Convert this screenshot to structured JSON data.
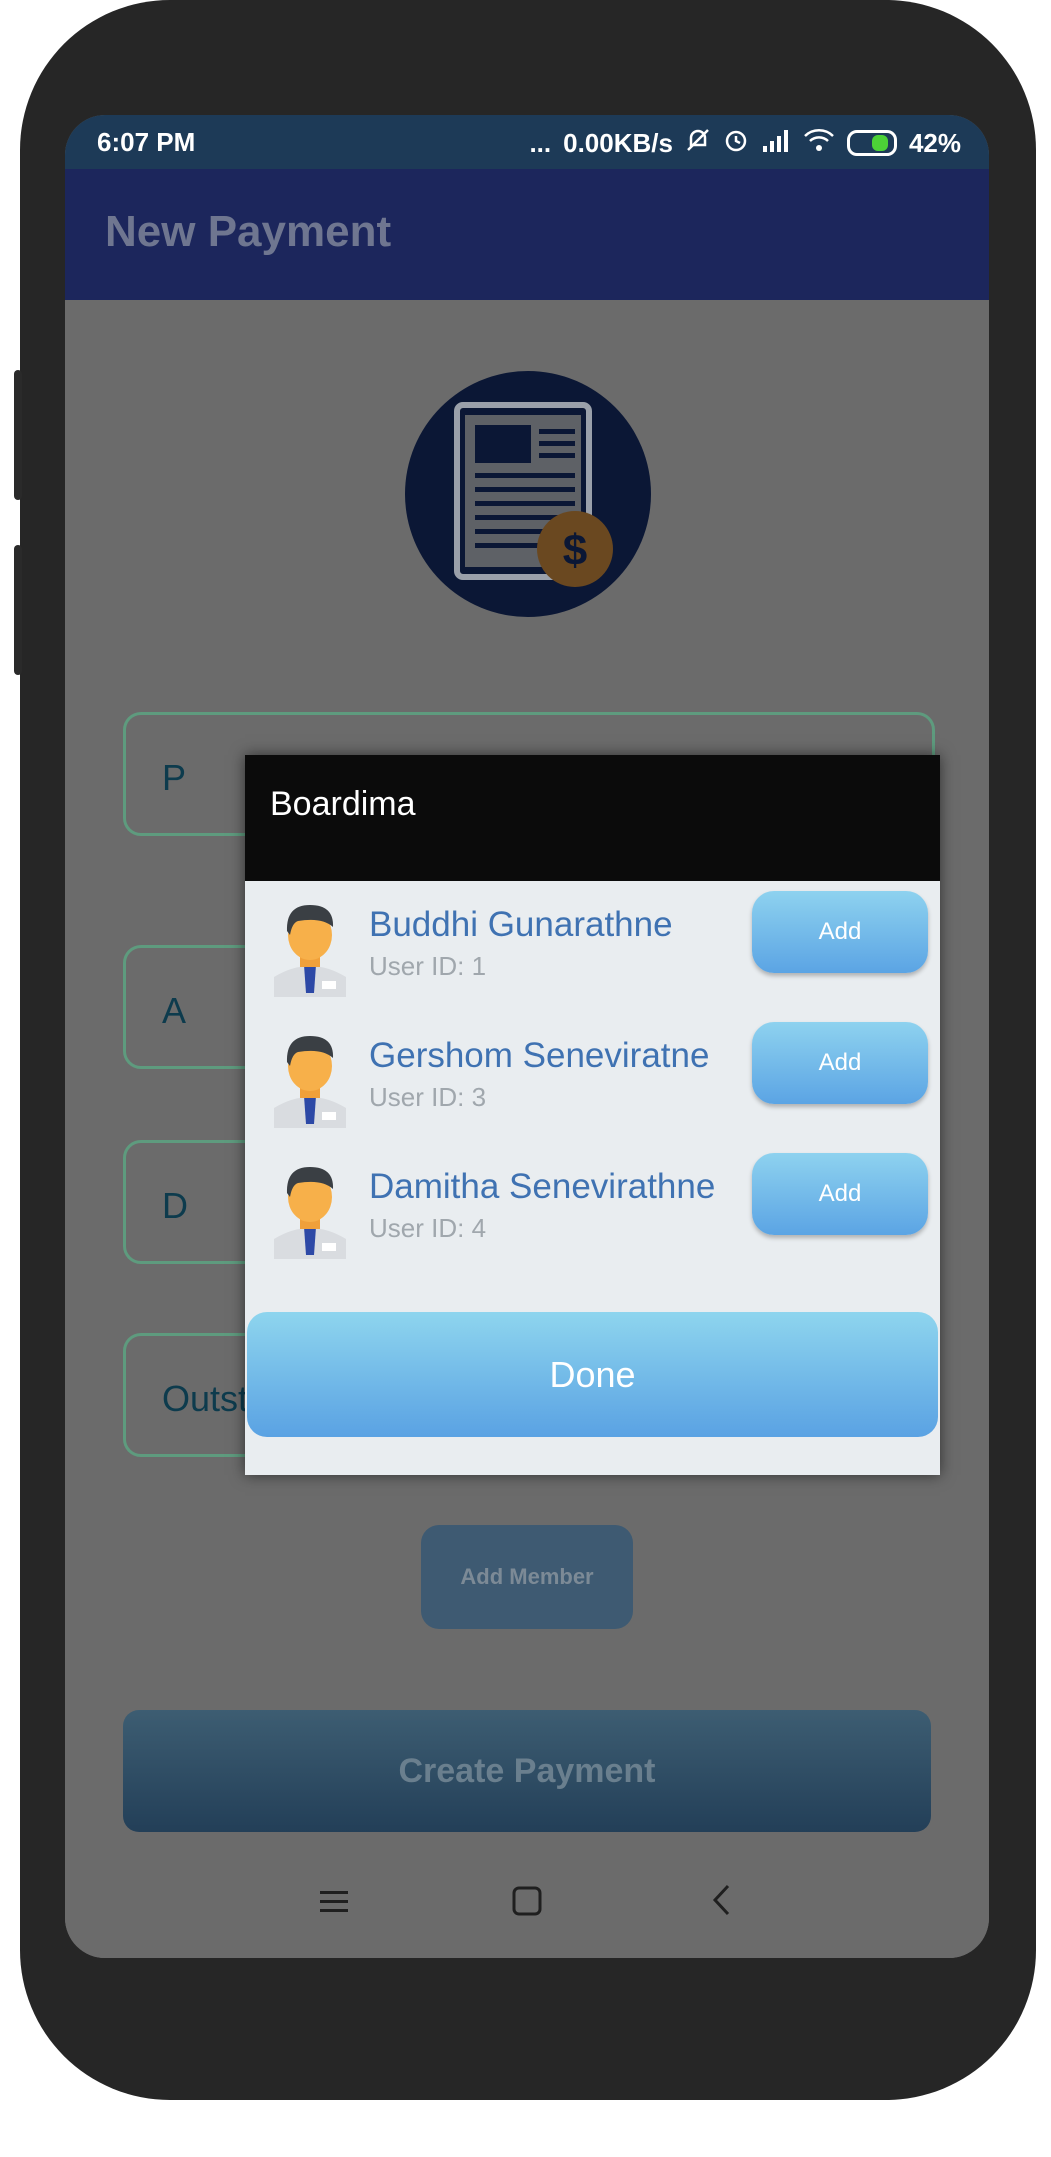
{
  "status_bar": {
    "time": "6:07 PM",
    "dots": "...",
    "network_speed": "0.00KB/s",
    "battery_percent": "42%",
    "icons": [
      "mute-icon",
      "alarm-icon",
      "signal-icon",
      "wifi-icon",
      "battery-charging-icon"
    ]
  },
  "app_bar": {
    "title": "New Payment"
  },
  "form": {
    "field1_label": "P",
    "field2_label": "A",
    "field3_label": "D",
    "field4_label": "Outstanding",
    "add_member_label": "Add Member",
    "create_payment_label": "Create Payment"
  },
  "dialog": {
    "title": "Boardima",
    "members": [
      {
        "name": "Buddhi Gunarathne",
        "user_id": "User ID: 1",
        "add_label": "Add"
      },
      {
        "name": "Gershom Seneviratne",
        "user_id": "User ID: 3",
        "add_label": "Add"
      },
      {
        "name": "Damitha Senevirathne",
        "user_id": "User ID: 4",
        "add_label": "Add"
      }
    ],
    "done_label": "Done"
  },
  "nav_bar": {
    "icons": [
      "menu-icon",
      "home-square-icon",
      "back-chevron-icon"
    ]
  },
  "colors": {
    "app_bar": "#1c265c",
    "status_bar": "#1d3a57",
    "dialog_header": "#0b0b0b",
    "button_gradient_top": "#8ed2ef",
    "button_gradient_bottom": "#5ba4e4",
    "member_name": "#3f72b2"
  }
}
